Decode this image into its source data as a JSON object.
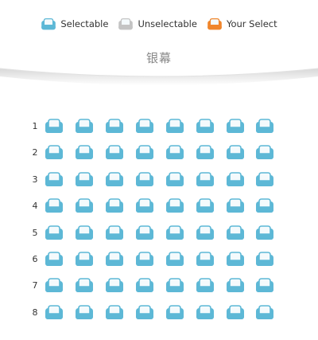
{
  "legend": [
    {
      "label": "Selectable",
      "color": "#5db8d6",
      "icon": "seat-icon"
    },
    {
      "label": "Unselectable",
      "color": "#c4c4c4",
      "icon": "seat-icon"
    },
    {
      "label": "Your Select",
      "color": "#f0862c",
      "icon": "seat-icon"
    }
  ],
  "screen": {
    "title": "银幕"
  },
  "colors": {
    "selectable": "#5db8d6",
    "selectable_dark": "#3f9fc0",
    "seat_inner": "#f4fafc"
  },
  "seating": {
    "seats_per_row": 8,
    "rows": [
      {
        "label": "1"
      },
      {
        "label": "2"
      },
      {
        "label": "3"
      },
      {
        "label": "4"
      },
      {
        "label": "5"
      },
      {
        "label": "6"
      },
      {
        "label": "7"
      },
      {
        "label": "8"
      }
    ]
  }
}
